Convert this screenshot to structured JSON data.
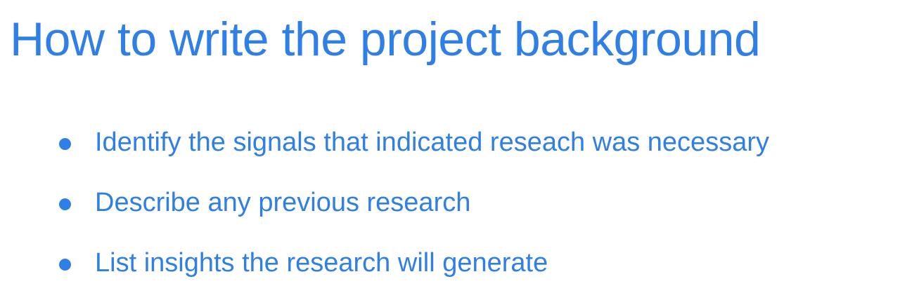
{
  "slide": {
    "title": "How to write the project background",
    "bullets": [
      "Identify the signals that indicated reseach was necessary",
      "Describe any previous research",
      "List insights the research will generate"
    ]
  },
  "colors": {
    "text": "#2f7fe6",
    "background": "#ffffff"
  }
}
